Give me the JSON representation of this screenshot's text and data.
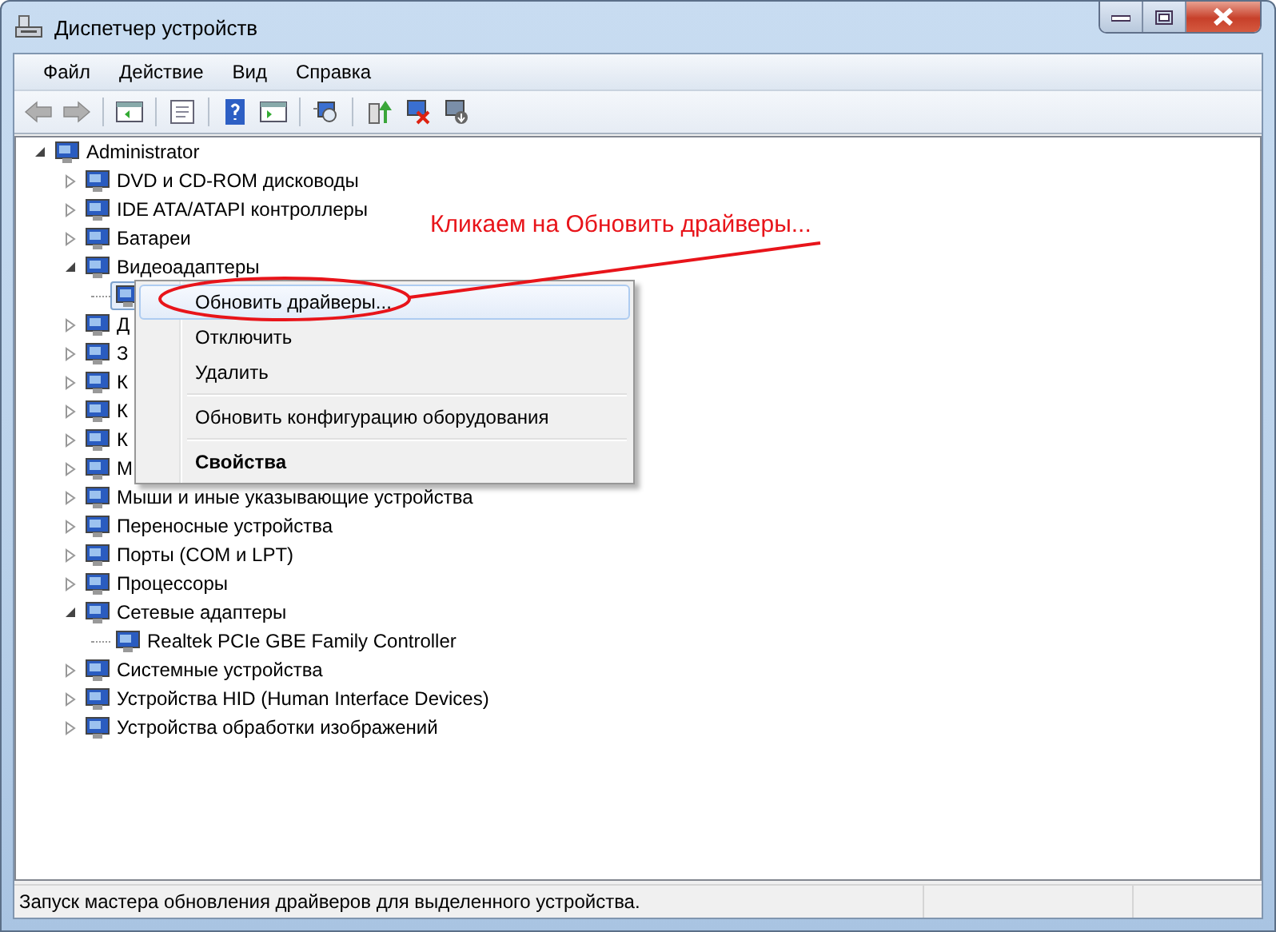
{
  "window": {
    "title": "Диспетчер устройств"
  },
  "menu": [
    {
      "label": "Файл"
    },
    {
      "label": "Действие"
    },
    {
      "label": "Вид"
    },
    {
      "label": "Справка"
    }
  ],
  "nav_buttons": [
    {
      "disabled": true
    },
    {
      "disabled": true
    }
  ],
  "tree": [
    {
      "label": "Administrator",
      "expanded": true,
      "selected": false,
      "children": [
        {
          "label": "DVD и CD-ROM дисководы",
          "expanded": false,
          "selected": false
        },
        {
          "label": "IDE ATA/ATAPI контроллеры",
          "expanded": false,
          "selected": false
        },
        {
          "label": "Батареи",
          "expanded": false,
          "selected": false
        },
        {
          "label": "Видеоадаптеры",
          "expanded": true,
          "selected": false,
          "children": [
            {
              "selected": true
            }
          ]
        },
        {
          "label": "Д",
          "expanded": false,
          "selected": false
        },
        {
          "label": "З",
          "expanded": false,
          "selected": false
        },
        {
          "label": "К",
          "expanded": false,
          "selected": false
        },
        {
          "label": "К",
          "expanded": false,
          "selected": false
        },
        {
          "label": "К",
          "expanded": false,
          "selected": false
        },
        {
          "label": "М",
          "expanded": false,
          "selected": false
        },
        {
          "label": "Мыши и иные указывающие устройства",
          "expanded": false,
          "selected": false
        },
        {
          "label": "Переносные устройства",
          "expanded": false,
          "selected": false
        },
        {
          "label": "Порты (COM и LPT)",
          "expanded": false,
          "selected": false
        },
        {
          "label": "Процессоры",
          "expanded": false,
          "selected": false
        },
        {
          "label": "Сетевые адаптеры",
          "expanded": true,
          "selected": false,
          "children": [
            {
              "label": "Realtek PCIe GBE Family Controller",
              "selected": false
            }
          ]
        },
        {
          "label": "Системные устройства",
          "expanded": false,
          "selected": false
        },
        {
          "label": "Устройства HID (Human Interface Devices)",
          "expanded": false,
          "selected": false
        },
        {
          "label": "Устройства обработки изображений",
          "expanded": false,
          "selected": false
        }
      ]
    }
  ],
  "context_menu": [
    {
      "kind": "item",
      "label": "Обновить драйверы...",
      "highlighted": true,
      "default": false
    },
    {
      "kind": "item",
      "label": "Отключить",
      "highlighted": false,
      "default": false
    },
    {
      "kind": "item",
      "label": "Удалить",
      "highlighted": false,
      "default": false
    },
    {
      "kind": "separator"
    },
    {
      "kind": "item",
      "label": "Обновить конфигурацию оборудования",
      "highlighted": false,
      "default": false
    },
    {
      "kind": "separator"
    },
    {
      "kind": "item",
      "label": "Свойства",
      "highlighted": false,
      "default": true
    }
  ],
  "annotation": {
    "text": "Кликаем на Обновить драйверы..."
  },
  "status_bar": {
    "text": "Запуск мастера обновления драйверов для выделенного устройства."
  }
}
